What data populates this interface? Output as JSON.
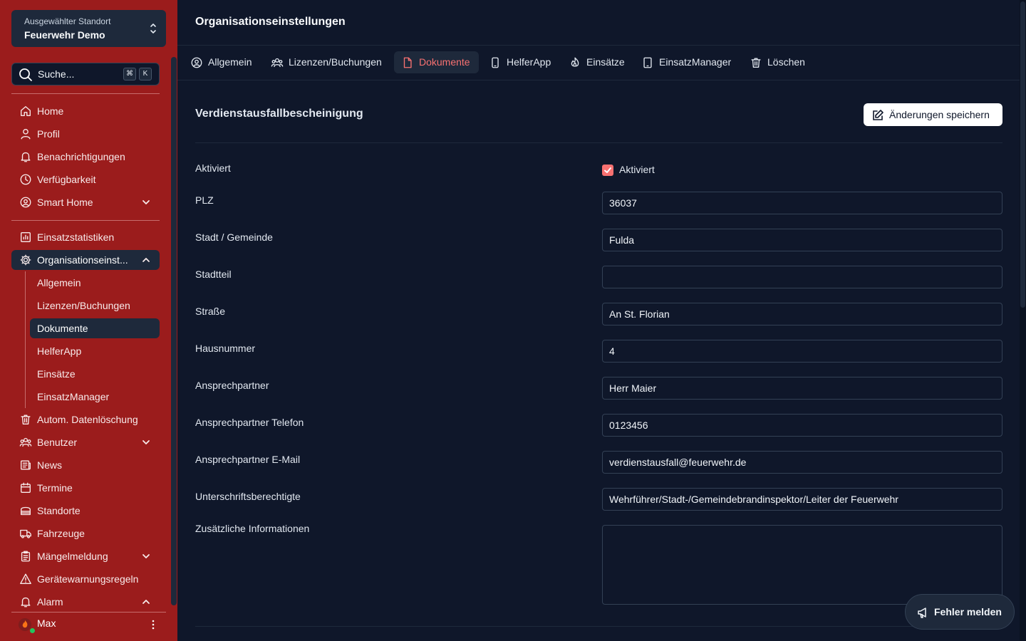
{
  "sidebar": {
    "location": {
      "label": "Ausgewählter Standort",
      "value": "Feuerwehr Demo"
    },
    "search": {
      "placeholder": "Suche...",
      "kbd": [
        "⌘",
        "K"
      ]
    },
    "items_top": [
      {
        "label": "Home",
        "icon": "home-icon"
      },
      {
        "label": "Profil",
        "icon": "user-icon"
      },
      {
        "label": "Benachrichtigungen",
        "icon": "bell-icon"
      },
      {
        "label": "Verfügbarkeit",
        "icon": "clock-icon"
      },
      {
        "label": "Smart Home",
        "icon": "user-circle-icon",
        "dropdown": "down"
      }
    ],
    "items_mid": [
      {
        "label": "Einsatzstatistiken",
        "icon": "chart-icon"
      },
      {
        "label": "Organisationseinst...",
        "icon": "gear-icon",
        "dropdown": "up",
        "active": true
      }
    ],
    "subitems": [
      {
        "label": "Allgemein"
      },
      {
        "label": "Lizenzen/Buchungen"
      },
      {
        "label": "Dokumente",
        "active": true
      },
      {
        "label": "HelferApp"
      },
      {
        "label": "Einsätze"
      },
      {
        "label": "EinsatzManager"
      }
    ],
    "items_bottom": [
      {
        "label": "Autom. Datenlöschung",
        "icon": "trash-icon"
      },
      {
        "label": "Benutzer",
        "icon": "users-icon",
        "dropdown": "down"
      },
      {
        "label": "News",
        "icon": "newspaper-icon"
      },
      {
        "label": "Termine",
        "icon": "calendar-icon"
      },
      {
        "label": "Standorte",
        "icon": "building-icon"
      },
      {
        "label": "Fahrzeuge",
        "icon": "truck-icon"
      },
      {
        "label": "Mängelmeldung",
        "icon": "clipboard-icon",
        "dropdown": "down"
      },
      {
        "label": "Gerätewarnungsregeln",
        "icon": "warning-icon"
      },
      {
        "label": "Alarm",
        "icon": "bell-icon",
        "dropdown": "up"
      }
    ],
    "user": {
      "name": "Max"
    }
  },
  "header": {
    "title": "Organisationseinstellungen"
  },
  "tabs": [
    {
      "label": "Allgemein",
      "icon": "user-circle-icon"
    },
    {
      "label": "Lizenzen/Buchungen",
      "icon": "users-icon"
    },
    {
      "label": "Dokumente",
      "icon": "document-icon",
      "active": true
    },
    {
      "label": "HelferApp",
      "icon": "phone-icon"
    },
    {
      "label": "Einsätze",
      "icon": "fire-icon"
    },
    {
      "label": "EinsatzManager",
      "icon": "tablet-icon"
    },
    {
      "label": "Löschen",
      "icon": "trash-icon"
    }
  ],
  "section": {
    "title": "Verdienstausfallbescheinigung",
    "save_label": "Änderungen speichern"
  },
  "form": {
    "activated": {
      "label": "Aktiviert",
      "checkbox_label": "Aktiviert",
      "checked": true
    },
    "fields": [
      {
        "label": "PLZ",
        "value": "36037"
      },
      {
        "label": "Stadt / Gemeinde",
        "value": "Fulda"
      },
      {
        "label": "Stadtteil",
        "value": ""
      },
      {
        "label": "Straße",
        "value": "An St. Florian"
      },
      {
        "label": "Hausnummer",
        "value": "4"
      },
      {
        "label": "Ansprechpartner",
        "value": "Herr Maier"
      },
      {
        "label": "Ansprechpartner Telefon",
        "value": "0123456"
      },
      {
        "label": "Ansprechpartner E-Mail",
        "value": "verdienstausfall@feuerwehr.de"
      },
      {
        "label": "Unterschriftsberechtigte",
        "value": "Wehrführer/Stadt-/Gemeindebrandinspektor/Leiter der Feuerwehr"
      }
    ],
    "extra": {
      "label": "Zusätzliche Informationen",
      "value": ""
    }
  },
  "report_button": {
    "label": "Fehler melden"
  },
  "colors": {
    "sidebar": "#9b1c1c",
    "background": "#0f172a",
    "accent": "#f87171",
    "online": "#22c55e"
  }
}
